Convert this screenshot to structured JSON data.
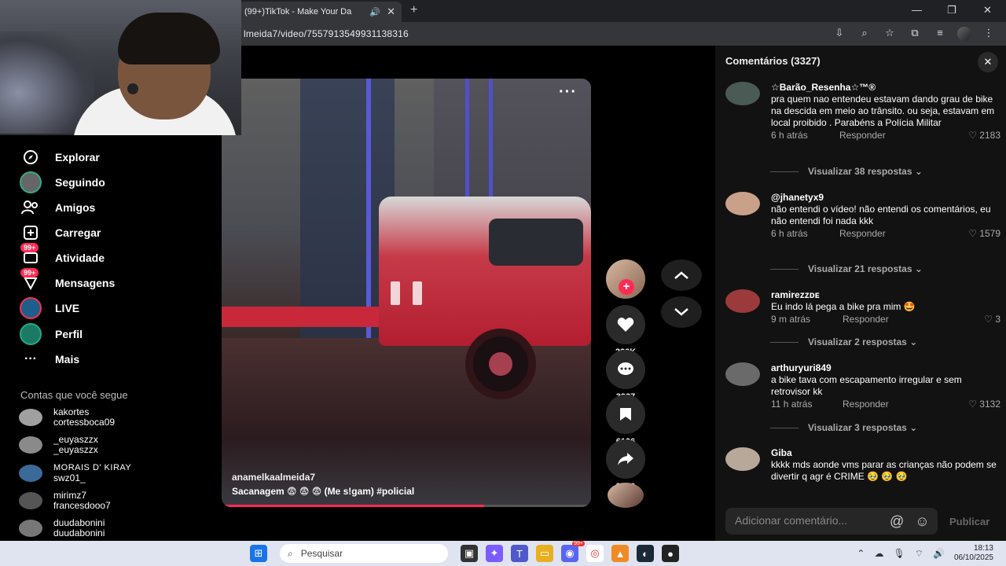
{
  "browser": {
    "tab_title": "(99+)TikTok - Make Your Da",
    "url": "lmeida7/video/7557913549931138316"
  },
  "sidebar": {
    "items": [
      {
        "label": "Explorar",
        "icon": "compass-icon"
      },
      {
        "label": "Seguindo",
        "icon": "avatar-ring-icon"
      },
      {
        "label": "Amigos",
        "icon": "friends-icon"
      },
      {
        "label": "Carregar",
        "icon": "plus-square-icon"
      },
      {
        "label": "Atividade",
        "icon": "activity-icon",
        "badge": "99+"
      },
      {
        "label": "Mensagens",
        "icon": "messages-icon",
        "badge": "99+"
      },
      {
        "label": "LIVE",
        "icon": "live-icon"
      },
      {
        "label": "Perfil",
        "icon": "profile-icon"
      },
      {
        "label": "Mais",
        "icon": "more-icon"
      }
    ],
    "following_title": "Contas que você segue",
    "following": [
      {
        "name": "kakortes",
        "handle": "cortessboca09"
      },
      {
        "name": "_euyaszzx",
        "handle": "_euyaszzx"
      },
      {
        "name": "MORAIS D' KIRAY",
        "handle": "swz01_"
      },
      {
        "name": "mirimz7",
        "handle": "francesdooo7"
      },
      {
        "name": "duudabonini",
        "handle": "duudabonini"
      }
    ]
  },
  "video": {
    "author": "anamelkaalmeida7",
    "caption": "Sacanagem 😨 😨 😨  (Me s!gam) #policial",
    "progress": 0.71
  },
  "actions": {
    "likes": "228K",
    "comments": "3327",
    "saves": "6196",
    "shares": "3999"
  },
  "comments_panel": {
    "title": "Comentários (3327)",
    "input_placeholder": "Adicionar comentário...",
    "post_label": "Publicar",
    "reply_label": "Responder",
    "items": [
      {
        "user": "☆Barão_Resenha☆™®",
        "text": "pra quem nao entendeu estavam dando grau de bike na descida em meio ao trânsito. ou seja, estavam em local proibido . Parabéns a Polícia Militar",
        "time": "6 h atrás",
        "likes": "2183",
        "replies": "Visualizar 38 respostas"
      },
      {
        "user": "@jhanetyx9",
        "text": "não entendi o vídeo! não entendi os comentários, eu não entendi foi nada kkk",
        "time": "6 h atrás",
        "likes": "1579",
        "replies": "Visualizar 21 respostas"
      },
      {
        "user": "ramirezzᴅᴇ",
        "text": "Eu indo lá pega a bike pra mim 🤩",
        "time": "9 m atrás",
        "likes": "3",
        "replies": "Visualizar 2 respostas"
      },
      {
        "user": "arthuryuri849",
        "text": "a bike tava com escapamento irregular e sem retrovisor kk",
        "time": "11 h atrás",
        "likes": "3132",
        "replies": "Visualizar 3 respostas"
      },
      {
        "user": "Giba",
        "text": "kkkk mds aonde vms parar as crianças não podem se divertir q agr é CRIME 🥹 🥹 🥹",
        "time": "",
        "likes": "",
        "replies": ""
      }
    ]
  },
  "taskbar": {
    "search_placeholder": "Pesquisar",
    "time": "18:13",
    "date": "06/10/2025",
    "messenger_badge": "99+"
  }
}
